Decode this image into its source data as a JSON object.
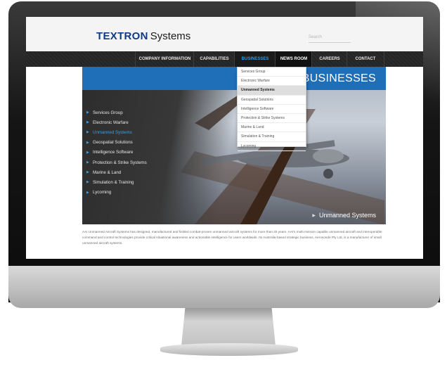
{
  "brand": {
    "name_bold": "TEXTRON",
    "name_rest": "Systems"
  },
  "search": {
    "placeholder": "Search"
  },
  "nav": {
    "items": [
      {
        "label": "COMPANY INFORMATION"
      },
      {
        "label": "CAPABILITIES"
      },
      {
        "label": "BUSINESSES"
      },
      {
        "label": "NEWS ROOM"
      },
      {
        "label": "CAREERS"
      },
      {
        "label": "CONTACT"
      }
    ],
    "active": "BUSINESSES"
  },
  "dropdown": {
    "items": [
      {
        "label": "Services Group"
      },
      {
        "label": "Electronic Warfare"
      },
      {
        "label": "Unmanned Systems"
      },
      {
        "label": "Geospatial Solutions"
      },
      {
        "label": "Intelligence Software"
      },
      {
        "label": "Protection & Strike Systems"
      },
      {
        "label": "Marine & Land"
      },
      {
        "label": "Simulation & Training"
      },
      {
        "label": "Lycoming"
      }
    ],
    "highlighted": "Unmanned Systems"
  },
  "hero": {
    "title": "BUSINESSES",
    "caption": "Unmanned Systems",
    "side_items": [
      {
        "label": "Services Group"
      },
      {
        "label": "Electronic Warfare"
      },
      {
        "label": "Unmanned Systems"
      },
      {
        "label": "Geospatial Solutions"
      },
      {
        "label": "Intelligence Software"
      },
      {
        "label": "Protection & Strike Systems"
      },
      {
        "label": "Marine & Land"
      },
      {
        "label": "Simulation & Training"
      },
      {
        "label": "Lycoming"
      }
    ],
    "current": "Unmanned Systems"
  },
  "body_text": "AAI Unmanned Aircraft Systems has designed, manufactured and fielded combat-proven unmanned aircraft systems for more than 25 years. AAI's multi-mission capable unmanned aircraft and interoperable command and control technologies provide critical situational awareness and actionable intelligence for users worldwide. Its Australia-based strategic business, Aerosonde Pty Ltd, is a manufacturer of small unmanned aircraft systems.",
  "colors": {
    "brand_blue": "#0d3b85",
    "accent_blue": "#1f6fb8",
    "link_blue": "#2f9be0",
    "nav_bg": "#2b2b2b"
  }
}
